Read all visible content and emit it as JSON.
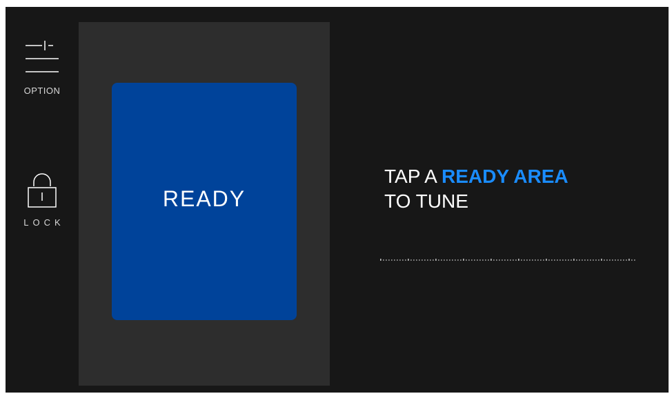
{
  "sidebar": {
    "option_label": "OPTION",
    "lock_label": "LOCK"
  },
  "pad": {
    "label": "READY"
  },
  "instruction": {
    "line1_prefix": "TAP A",
    "line1_highlight": "READY AREA",
    "line2": "TO TUNE"
  },
  "colors": {
    "background": "#171717",
    "panel": "#2d2d2d",
    "pad": "#00439a",
    "accent": "#1a8cff",
    "text": "#ffffff"
  },
  "icons": {
    "option": "sliders-icon",
    "lock": "padlock-icon"
  }
}
